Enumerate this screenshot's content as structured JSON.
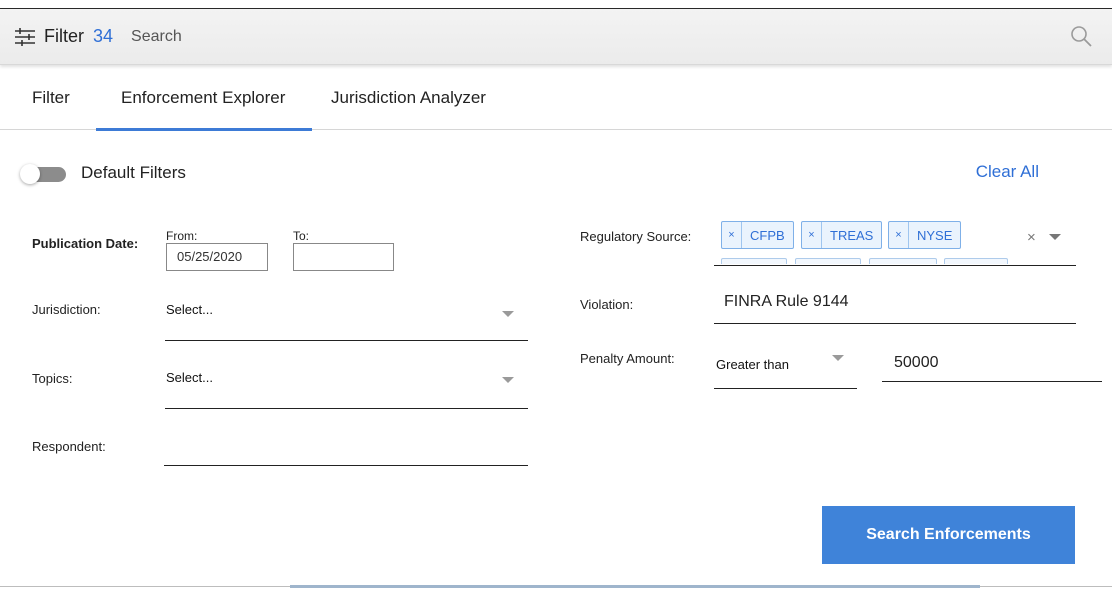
{
  "topbar": {
    "filter_label": "Filter",
    "filter_count": "34",
    "search_placeholder": "Search",
    "accent_color": "#2f6fd6"
  },
  "tabs": [
    {
      "label": "Filter",
      "active": false
    },
    {
      "label": "Enforcement Explorer",
      "active": true
    },
    {
      "label": "Jurisdiction Analyzer",
      "active": false
    }
  ],
  "default_filters": {
    "label": "Default Filters",
    "enabled": false,
    "clear_all": "Clear All"
  },
  "form": {
    "publication_date": {
      "label": "Publication Date:",
      "from_label": "From:",
      "from_value": "05/25/2020",
      "to_label": "To:",
      "to_value": ""
    },
    "jurisdiction": {
      "label": "Jurisdiction:",
      "value": "Select..."
    },
    "topics": {
      "label": "Topics:",
      "value": "Select..."
    },
    "respondent": {
      "label": "Respondent:",
      "value": ""
    },
    "regulatory_source": {
      "label": "Regulatory Source:",
      "tags": [
        "CFPB",
        "TREAS",
        "NYSE"
      ],
      "tag_remove_glyph": "×",
      "clear_glyph": "×"
    },
    "violation": {
      "label": "Violation:",
      "value": "FINRA Rule 9144"
    },
    "penalty_amount": {
      "label": "Penalty Amount:",
      "operator": "Greater than",
      "value": "50000"
    }
  },
  "actions": {
    "search_button": "Search Enforcements",
    "button_color": "#3f83d9"
  },
  "icons": {
    "filter": "sliders-icon",
    "search": "magnifier-icon",
    "dropdown": "caret-down-icon"
  }
}
